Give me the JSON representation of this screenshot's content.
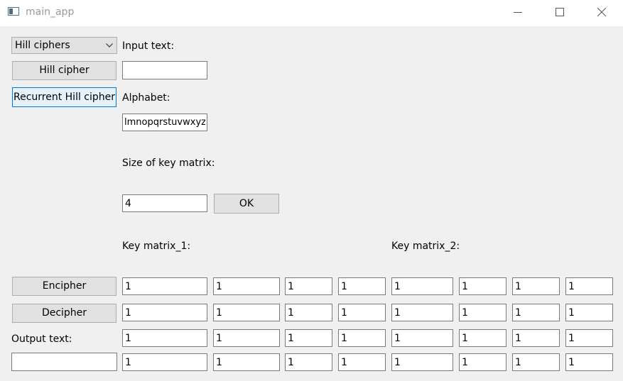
{
  "window": {
    "title": "main_app"
  },
  "cipher_select": {
    "value": "Hill ciphers"
  },
  "buttons": {
    "hill_cipher": "Hill cipher",
    "recurrent_hill_cipher": "Recurrent Hill cipher",
    "ok": "OK",
    "encipher": "Encipher",
    "decipher": "Decipher"
  },
  "labels": {
    "input_text": "Input text:",
    "alphabet": "Alphabet:",
    "key_size": "Size of key matrix:",
    "key_matrix_1": "Key matrix_1:",
    "key_matrix_2": "Key matrix_2:",
    "output_text": "Output text:"
  },
  "fields": {
    "input_text": "",
    "alphabet": "lmnopqrstuvwxyz",
    "key_size": "4",
    "output_text": ""
  },
  "key_matrix_1": [
    [
      "1",
      "1",
      "1",
      "1"
    ],
    [
      "1",
      "1",
      "1",
      "1"
    ],
    [
      "1",
      "1",
      "1",
      "1"
    ],
    [
      "1",
      "1",
      "1",
      "1"
    ]
  ],
  "key_matrix_2": [
    [
      "1",
      "1",
      "1",
      "1"
    ],
    [
      "1",
      "1",
      "1",
      "1"
    ],
    [
      "1",
      "1",
      "1",
      "1"
    ],
    [
      "1",
      "1",
      "1",
      "1"
    ]
  ]
}
